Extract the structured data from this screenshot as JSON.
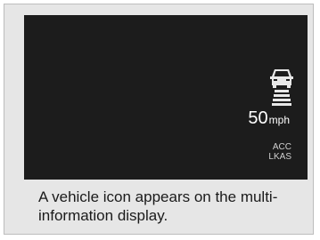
{
  "display": {
    "speed_value": "50",
    "speed_unit": "mph",
    "status_line1": "ACC",
    "status_line2": "LKAS",
    "icon": "vehicle-ahead-icon"
  },
  "caption": {
    "text": "A vehicle icon appears on the multi-information display."
  },
  "colors": {
    "panel_background": "#e6e6e6",
    "display_background": "#1c1c1c",
    "display_text": "#ffffff"
  }
}
